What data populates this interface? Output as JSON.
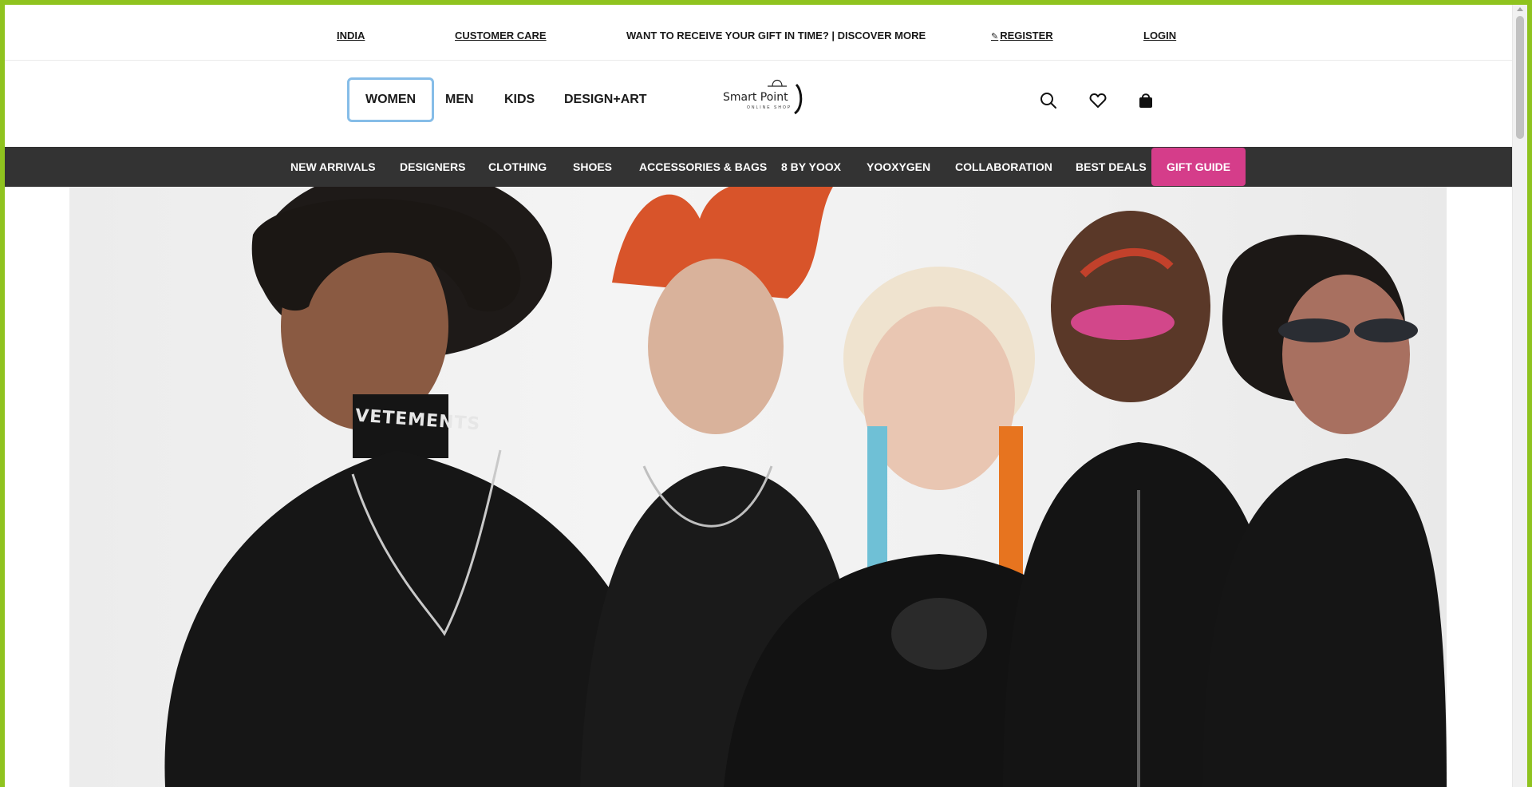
{
  "topbar": {
    "country": "INDIA",
    "customer_care": "CUSTOMER CARE",
    "promo": "WANT TO RECEIVE YOUR GIFT IN TIME? | DISCOVER MORE",
    "register": "REGISTER",
    "login": "LOGIN"
  },
  "header": {
    "genders": [
      "WOMEN",
      "MEN",
      "KIDS",
      "DESIGN+ART"
    ],
    "active_gender": "WOMEN",
    "logo": {
      "name": "Smart Point",
      "tagline": "ONLINE SHOP"
    },
    "icons": [
      "search-icon",
      "heart-icon",
      "bag-icon"
    ]
  },
  "nav": {
    "items": [
      "NEW ARRIVALS",
      "DESIGNERS",
      "CLOTHING",
      "SHOES",
      "ACCESSORIES & BAGS",
      "8 BY YOOX",
      "YOOXYGEN",
      "COLLABORATION",
      "BEST DEALS",
      "GIFT GUIDE"
    ],
    "highlight_color": "#d53d8a",
    "bar_color": "#333333"
  },
  "hero": {
    "necklace_text": "VETEMENTS"
  },
  "colors": {
    "frame": "#8fc31f",
    "active_outline": "#86bde8"
  }
}
